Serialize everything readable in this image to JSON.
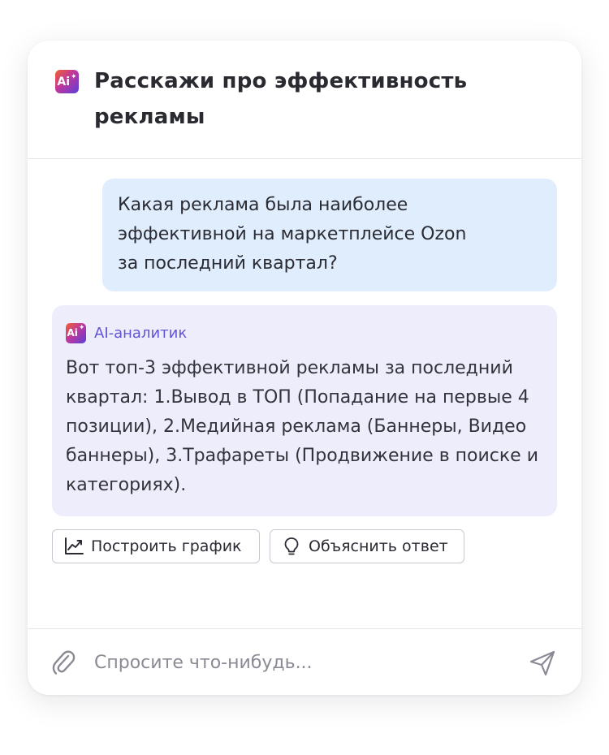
{
  "header": {
    "logo_text": "Ai",
    "title": "Расскажи про эффективность рекламы"
  },
  "messages": {
    "user": "Какая реклама была наиболее\nэффективной на маркетплейсе Ozon\nза последний квартал?",
    "ai": {
      "sender": "AI-аналитик",
      "logo_text": "Ai",
      "text": "Вот топ-3 эффективной рекламы за последний квартал: 1.Вывод в ТОП (Попадание на первые 4 позиции), 2.Медийная реклама (Баннеры, Видео баннеры), 3.Трафареты (Продвижение в поиске и категориях)."
    }
  },
  "actions": {
    "build_chart": {
      "label": "Построить график",
      "icon": "chart-line-icon"
    },
    "explain": {
      "label": "Объяснить ответ",
      "icon": "lightbulb-icon"
    }
  },
  "composer": {
    "placeholder": "Спросите что-нибудь...",
    "attach_icon": "paperclip-icon",
    "send_icon": "send-icon"
  },
  "colors": {
    "user_bubble": "#dfedfd",
    "ai_bubble": "#eeedfc",
    "ai_accent": "#6254d6"
  }
}
